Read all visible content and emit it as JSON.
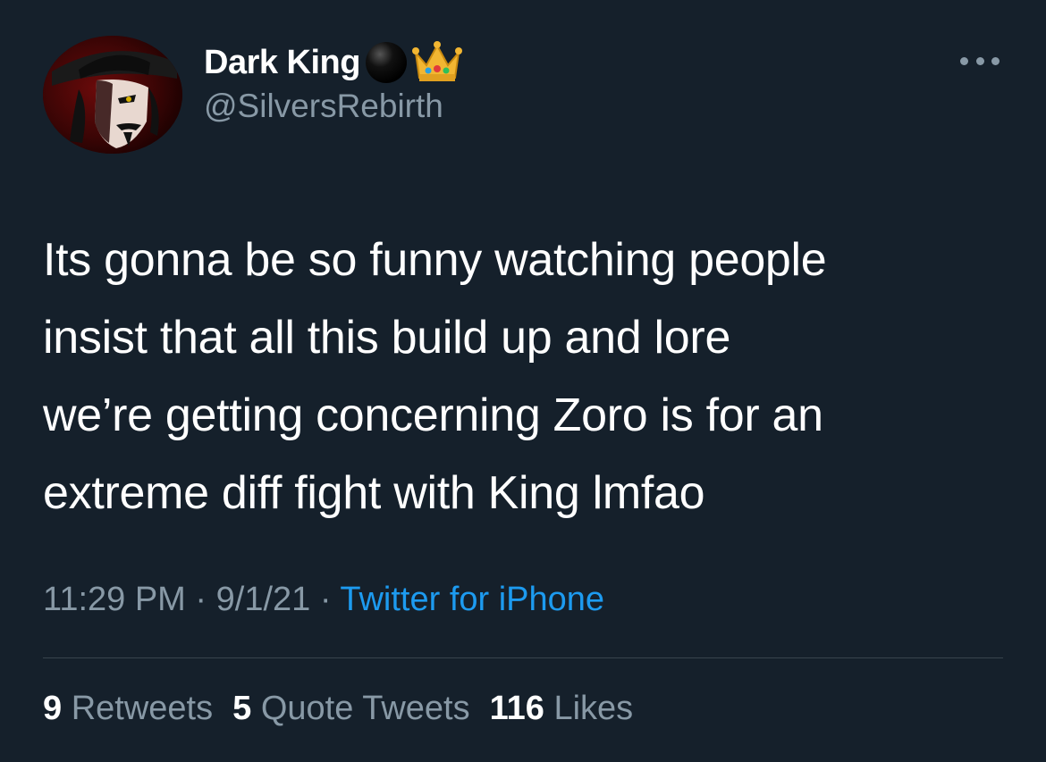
{
  "tweet": {
    "author": {
      "display_name": "Dark King",
      "handle": "@SilversRebirth",
      "name_emojis": [
        "black-circle-icon",
        "crown-icon"
      ]
    },
    "text_lines": [
      "Its gonna be so funny watching people",
      "insist that all this build up and lore",
      "we’re getting concerning Zoro is for an",
      "extreme diff fight with King lmfao"
    ],
    "time": "11:29 PM",
    "date": "9/1/21",
    "separator": "·",
    "source": "Twitter for iPhone",
    "stats": {
      "retweets_count": "9",
      "retweets_label": "Retweets",
      "quote_count": "5",
      "quote_label": "Quote Tweets",
      "likes_count": "116",
      "likes_label": "Likes"
    }
  },
  "colors": {
    "background": "#15202b",
    "secondary_text": "#8899a6",
    "link": "#1d9bf0",
    "divider": "#38444d"
  }
}
